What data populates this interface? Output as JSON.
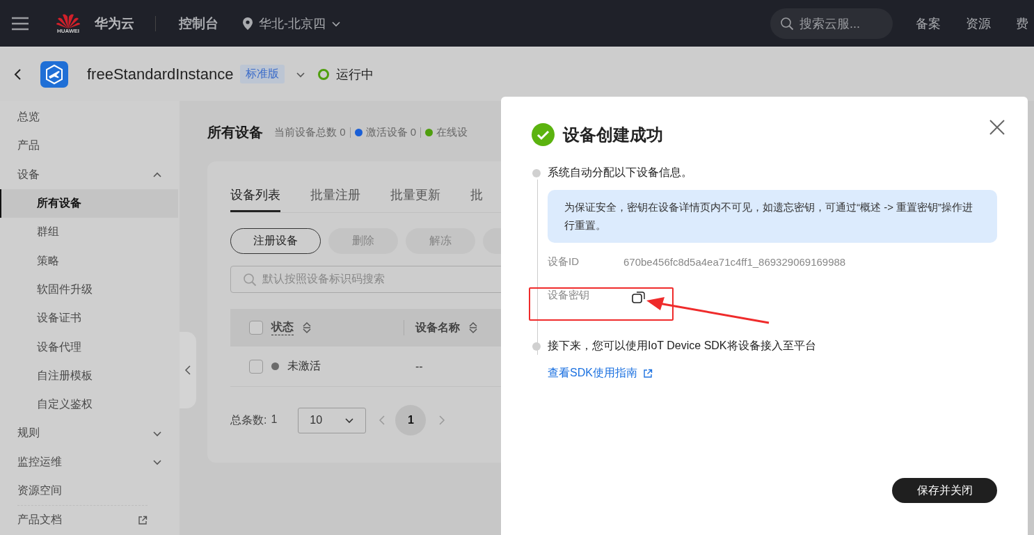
{
  "topbar": {
    "logo_text": "HUAWEI",
    "brand": "华为云",
    "console": "控制台",
    "region": "华北-北京四",
    "search_placeholder": "搜索云服...",
    "links": [
      "备案",
      "资源",
      "费"
    ]
  },
  "instance": {
    "name": "freeStandardInstance",
    "edition": "标准版",
    "status": "运行中"
  },
  "sidebar": {
    "items": [
      {
        "label": "总览",
        "selected": false
      },
      {
        "label": "产品",
        "selected": false
      },
      {
        "label": "设备",
        "expanded": true,
        "selected": false,
        "children": [
          {
            "label": "所有设备",
            "selected": true
          },
          {
            "label": "群组",
            "selected": false
          },
          {
            "label": "策略",
            "selected": false
          },
          {
            "label": "软固件升级",
            "selected": false
          },
          {
            "label": "设备证书",
            "selected": false
          },
          {
            "label": "设备代理",
            "selected": false
          },
          {
            "label": "自注册模板",
            "selected": false
          },
          {
            "label": "自定义鉴权",
            "selected": false
          }
        ]
      },
      {
        "label": "规则",
        "expanded": false,
        "selected": false,
        "kind": "group"
      },
      {
        "label": "监控运维",
        "expanded": false,
        "selected": false,
        "kind": "group"
      },
      {
        "label": "资源空间",
        "selected": false
      },
      {
        "label": "产品文档",
        "selected": false,
        "kind": "external"
      }
    ]
  },
  "page": {
    "title": "所有设备",
    "stats": [
      {
        "label": "当前设备总数",
        "count": "0"
      },
      {
        "label": "激活设备",
        "count": "0",
        "color": "#1a5fd6"
      },
      {
        "label": "在线设",
        "color": "#4f9e0e"
      }
    ]
  },
  "tabs": [
    {
      "label": "设备列表",
      "selected": true
    },
    {
      "label": "批量注册",
      "selected": false
    },
    {
      "label": "批量更新",
      "selected": false
    },
    {
      "label": "批",
      "selected": false
    }
  ],
  "actions": [
    {
      "label": "注册设备",
      "disabled": false
    },
    {
      "label": "删除",
      "disabled": true
    },
    {
      "label": "解冻",
      "disabled": true
    },
    {
      "disabled": true
    }
  ],
  "search": {
    "placeholder": "默认按照设备标识码搜索"
  },
  "table": {
    "header_checked": false,
    "columns": [
      {
        "label": "状态"
      },
      {
        "label": "设备名称"
      }
    ],
    "rows": [
      {
        "checked": false,
        "status": "未激活",
        "color": "#6b6b6b",
        "name": "--"
      }
    ]
  },
  "pagination": {
    "total_label": "总条数:",
    "total": "1",
    "page_size": "10",
    "pages": [
      {
        "label": "1",
        "selected": true
      }
    ]
  },
  "dialog": {
    "title": "设备创建成功",
    "step1": "系统自动分配以下设备信息。",
    "notice": "为保证安全，密钥在设备详情页内不可见，如遗忘密钥，可通过“概述 -> 重置密钥”操作进行重置。",
    "fields": [
      {
        "kind": "text",
        "label": "设备ID",
        "value": "670be456fc8d5a4ea71c4ff1_869329069169988"
      },
      {
        "kind": "copy",
        "label": "设备密钥"
      }
    ],
    "step2": "接下来，您可以使用IoT Device SDK将设备接入至平台",
    "link": "查看SDK使用指南",
    "button": "保存并关闭"
  }
}
